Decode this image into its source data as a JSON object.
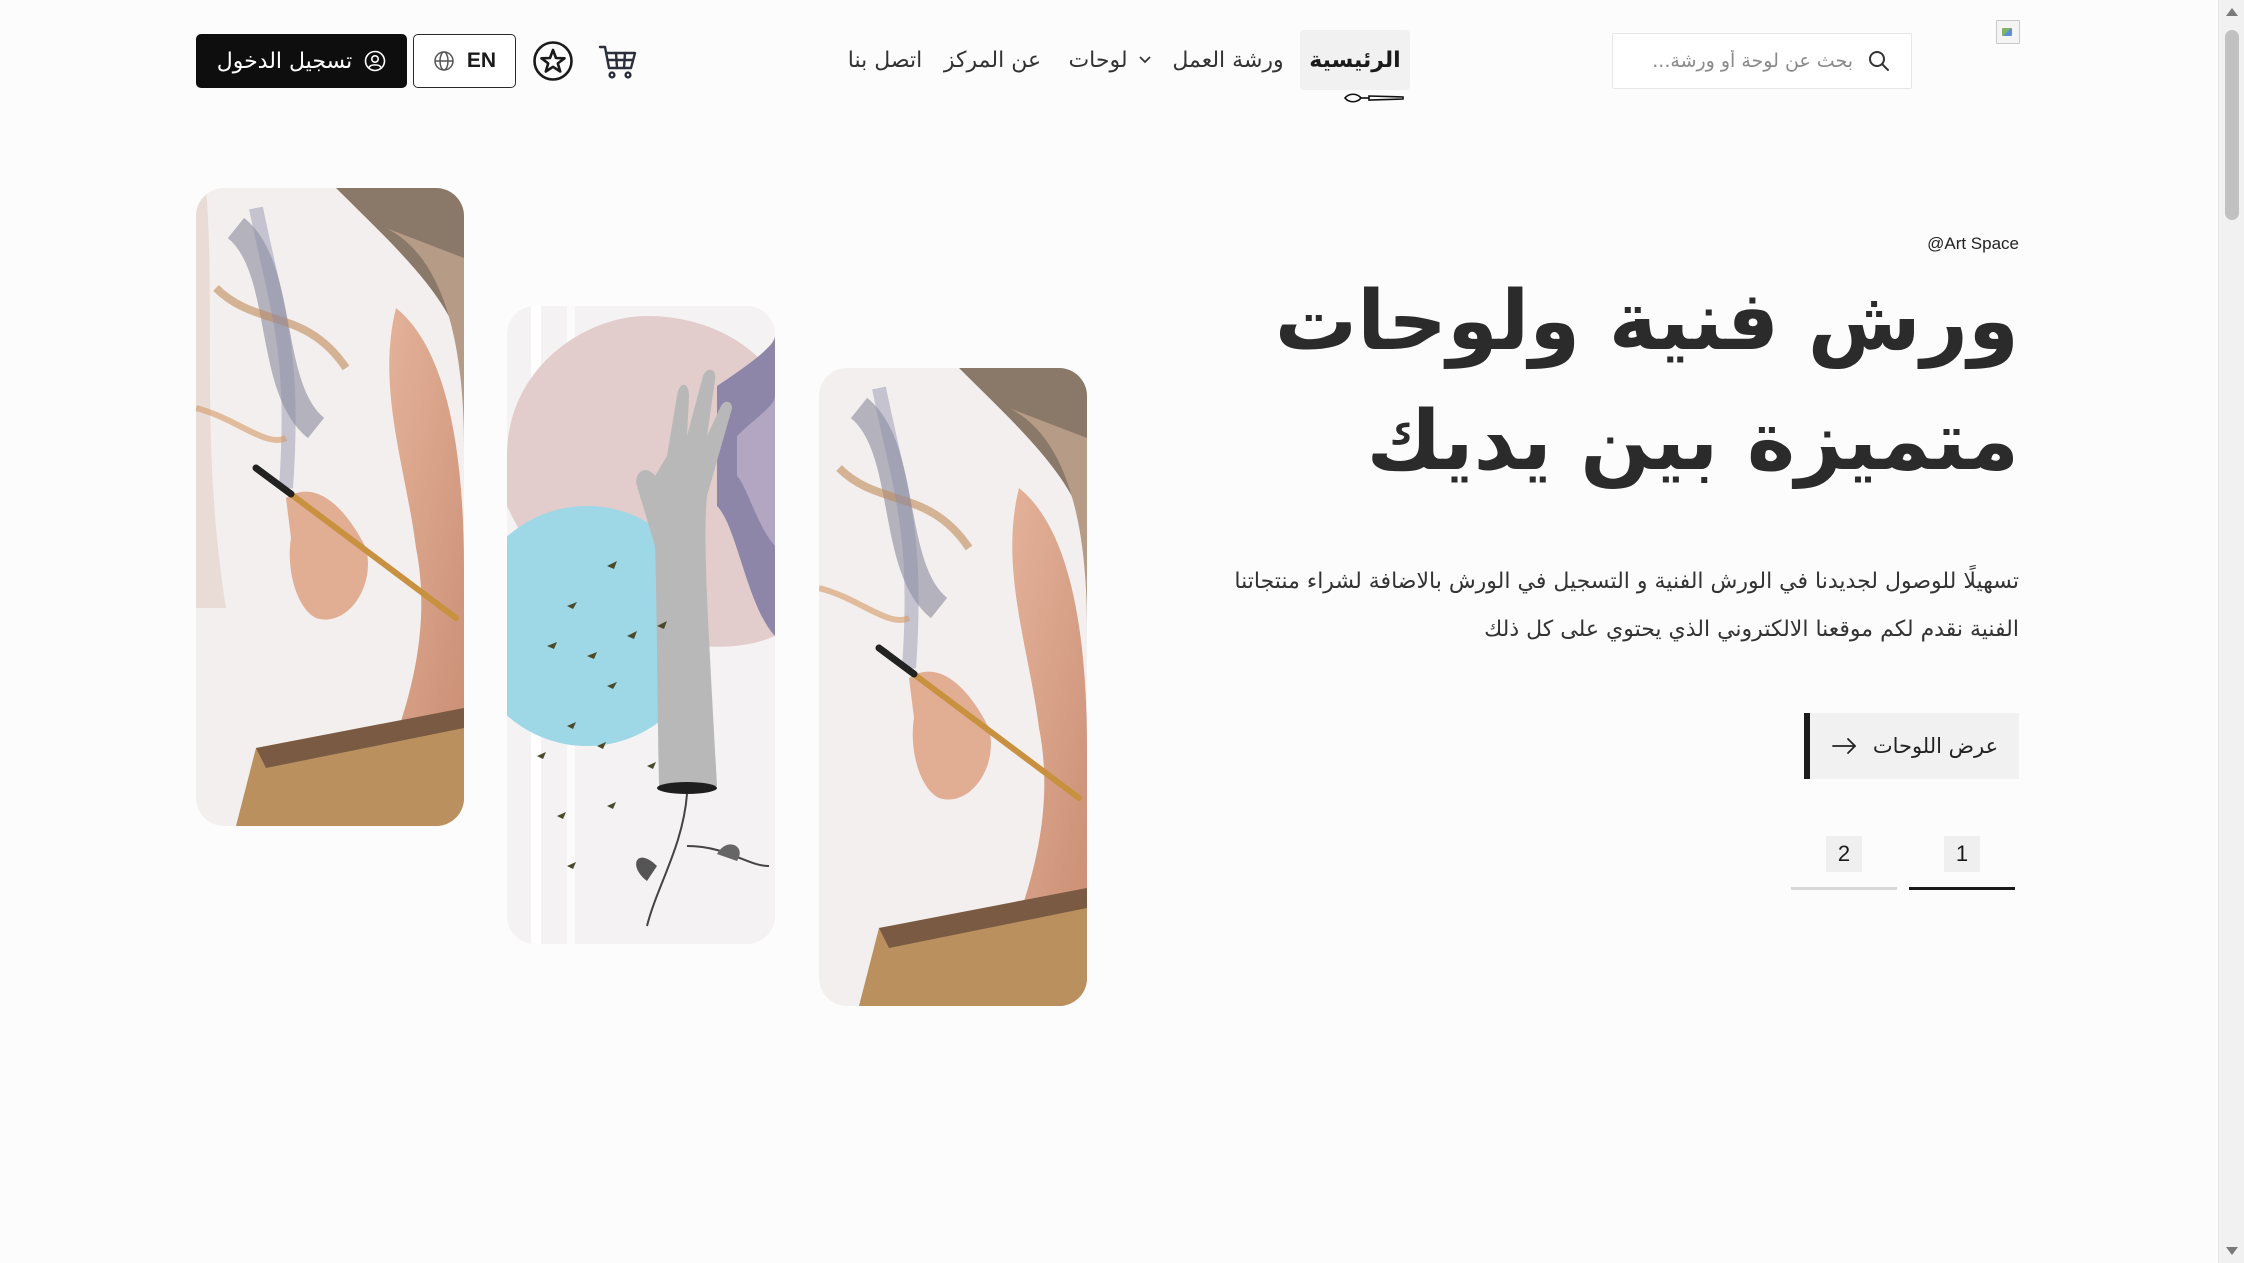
{
  "header": {
    "search": {
      "placeholder": "بحث عن لوحة أو ورشة..."
    },
    "nav": [
      {
        "label": "الرئيسية",
        "active": true
      },
      {
        "label": "ورشة العمل"
      },
      {
        "label": "لوحات",
        "has_dropdown": true
      },
      {
        "label": "عن المركز"
      },
      {
        "label": "اتصل بنا"
      }
    ],
    "language_label": "EN",
    "login_label": "تسجيل الدخول",
    "icons": [
      "logo-image",
      "search-icon",
      "chevron-down-icon",
      "paintbrush-icon",
      "cart-icon",
      "star-icon",
      "globe-icon",
      "user-icon"
    ]
  },
  "hero": {
    "brand_tag": "@Art Space",
    "title_line1": "ورش فنية ولوحات",
    "title_line2": "متميزة بين يديك",
    "description_line1": "تسهيلًا للوصول لجديدنا في الورش الفنية و التسجيل في الورش بالاضافة لشراء منتجاتنا",
    "description_line2": "الفنية نقدم لكم موقعنا الالكتروني الذي يحتوي على كل ذلك",
    "cta_label": "عرض اللوحات",
    "pagination": [
      {
        "label": "1",
        "active": true
      },
      {
        "label": "2",
        "active": false
      }
    ]
  },
  "colors": {
    "background": "#fdfcfc",
    "primary_dark": "#0e0e0e",
    "text": "#2b2b2b",
    "muted_bg": "#f2f1f1",
    "accent_sky": "#9ed8e6",
    "accent_pink": "#e2cccc"
  }
}
